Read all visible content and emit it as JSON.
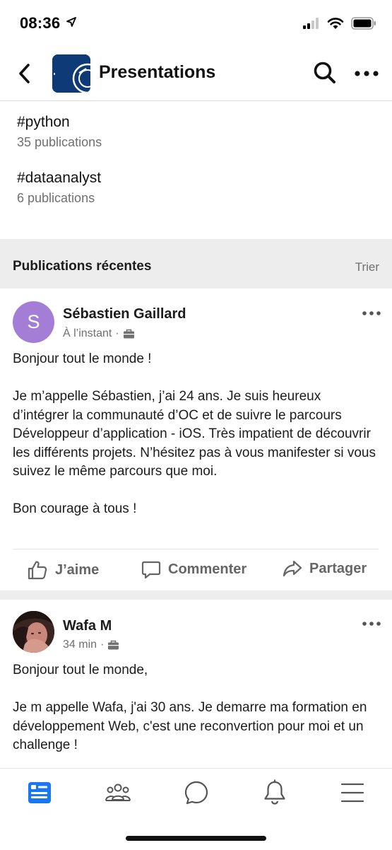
{
  "status_bar": {
    "time": "08:36",
    "icons": [
      "location-arrow-icon",
      "signal-icon",
      "wifi-icon",
      "battery-icon"
    ]
  },
  "header": {
    "title": "Presentations",
    "icons": [
      "back-chevron-icon",
      "search-icon",
      "more-horizontal-icon"
    ]
  },
  "hashtags": [
    {
      "name": "#python",
      "count": "35 publications"
    },
    {
      "name": "#dataanalyst",
      "count": "6 publications"
    }
  ],
  "section": {
    "title": "Publications récentes",
    "sort_label": "Trier"
  },
  "posts": [
    {
      "avatar_letter": "S",
      "avatar_color": "#a47ed6",
      "author": "Sébastien Gaillard",
      "time": "À l’instant",
      "body": "Bonjour tout le monde !\n\nJe m’appelle Sébastien, j’ai 24 ans. Je suis heureux d’intégrer la communauté d’OC et de suivre le parcours Développeur d’application - iOS. Très impatient de découvrir les différents projets. N’hésitez pas à vous manifester si vous suivez le même parcours que moi.\n\nBon courage à tous !"
    },
    {
      "author": "Wafa M",
      "time": "34 min",
      "body": "Bonjour tout le monde,\n\nJe m appelle Wafa, j'ai 30 ans. Je demarre ma formation en développement Web, c'est une reconvertion pour moi et un challenge !"
    }
  ],
  "actions": {
    "like": "J’aime",
    "comment": "Commenter",
    "share": "Partager"
  },
  "bottom_nav": [
    "feed-icon",
    "groups-icon",
    "messages-icon",
    "notifications-icon",
    "menu-icon"
  ],
  "colors": {
    "accent": "#1877f2",
    "group_logo": "#0e3a78",
    "section_bg": "#ededed",
    "muted_text": "#707070"
  }
}
